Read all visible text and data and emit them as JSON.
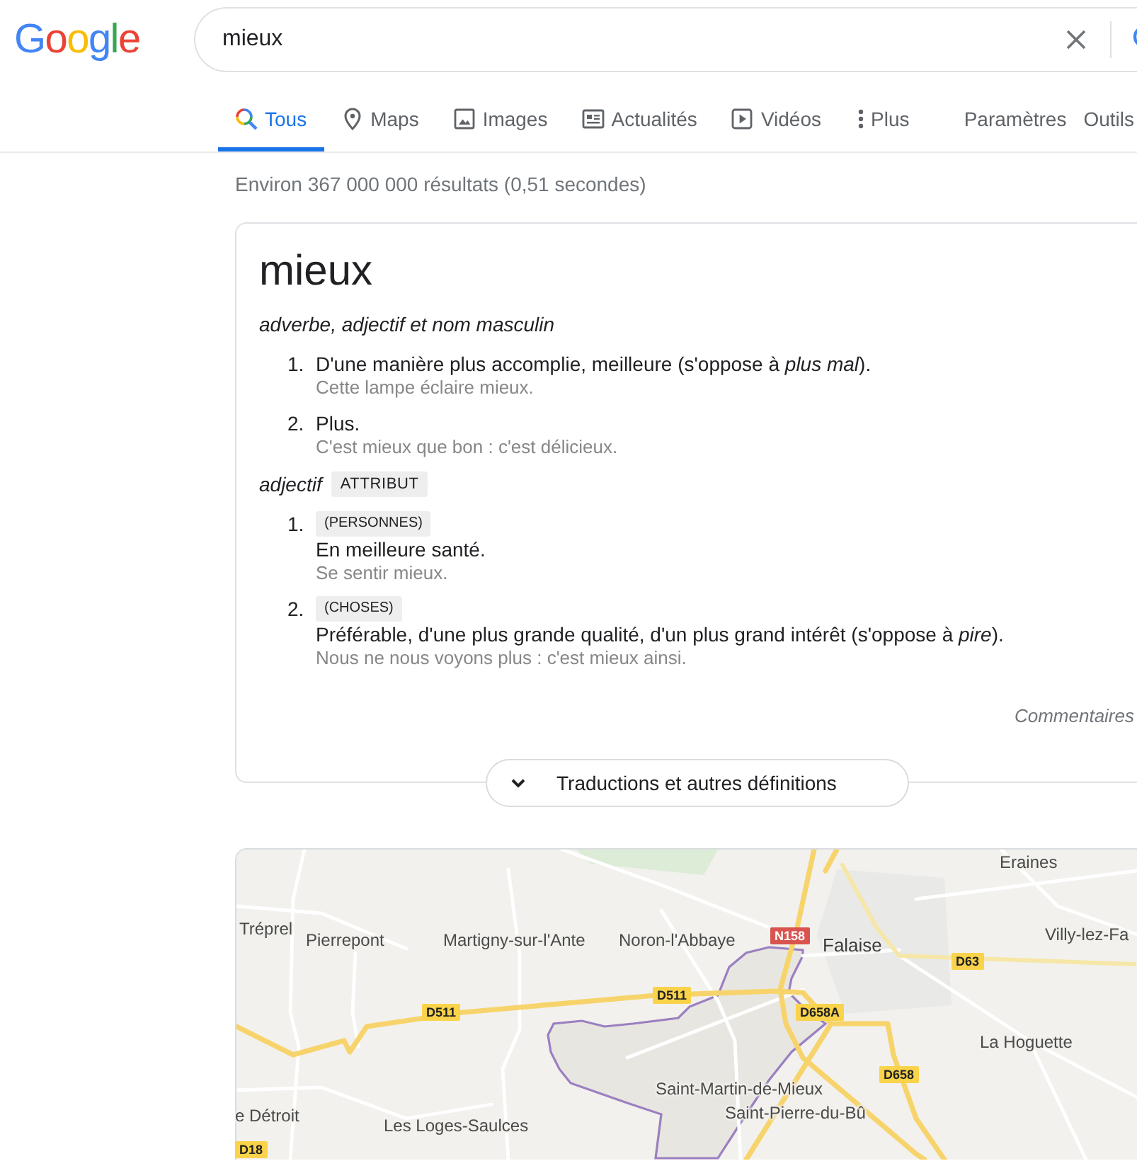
{
  "header": {
    "logo": "Google",
    "search": {
      "value": "mieux"
    }
  },
  "tabs": [
    {
      "kind": "all",
      "label": "Tous",
      "selected": true
    },
    {
      "kind": "maps",
      "label": "Maps",
      "selected": false
    },
    {
      "kind": "images",
      "label": "Images",
      "selected": false
    },
    {
      "kind": "news",
      "label": "Actualités",
      "selected": false
    },
    {
      "kind": "videos",
      "label": "Vidéos",
      "selected": false
    },
    {
      "kind": "more",
      "label": "Plus",
      "selected": false
    }
  ],
  "tools": [
    "Paramètres",
    "Outils"
  ],
  "result_stats": "Environ 367 000 000 résultats (0,51 secondes)",
  "definition": {
    "word": "mieux",
    "senses": [
      {
        "pos": "adverbe, adjectif et nom masculin",
        "definitions": [
          {
            "number": "1.",
            "text": "D'une manière plus accomplie, meilleure (s'oppose à *plus mal*).",
            "example": "Cette lampe éclaire mieux."
          },
          {
            "number": "2.",
            "text": "Plus.",
            "example": "C'est mieux que bon : c'est délicieux."
          }
        ]
      },
      {
        "pos": "adjectif",
        "tag": "ATTRIBUT",
        "definitions": [
          {
            "number": "1.",
            "label": "(PERSONNES)",
            "text": "En meilleure santé.",
            "example": "Se sentir mieux."
          },
          {
            "number": "2.",
            "label": "(CHOSES)",
            "text": "Préférable, d'une plus grande qualité, d'un plus grand intérêt (s'oppose à *pire*).",
            "example": "Nous ne nous voyons plus : c'est mieux ainsi."
          }
        ]
      }
    ],
    "feedback": "Commentaires",
    "more_button": "Traductions et autres définitions"
  },
  "map": {
    "places": [
      {
        "kind": "village",
        "name": "Eraines"
      },
      {
        "kind": "village",
        "name": "Tréprel"
      },
      {
        "kind": "village",
        "name": "Pierrepont"
      },
      {
        "kind": "village",
        "name": "Martigny-sur-l'Ante"
      },
      {
        "kind": "village",
        "name": "Noron-l'Abbaye"
      },
      {
        "kind": "town",
        "name": "Falaise"
      },
      {
        "kind": "village",
        "name": "Villy-lez-Fa"
      },
      {
        "kind": "village",
        "name": "La Hoguette"
      },
      {
        "kind": "village",
        "name": "Saint-Martin-de-Mieux"
      },
      {
        "kind": "village",
        "name": "e Détroit"
      },
      {
        "kind": "village",
        "name": "Saint-Pierre-du-Bû"
      },
      {
        "kind": "village",
        "name": "Les Loges-Saulces"
      }
    ],
    "road_numbers": [
      {
        "label": "N158",
        "color": "#d9534f"
      },
      {
        "label": "D63",
        "color": "#f9d34a"
      },
      {
        "label": "D511",
        "color": "#f9d34a"
      },
      {
        "label": "D511",
        "color": "#f9d34a"
      },
      {
        "label": "D658A",
        "color": "#f9d34a"
      },
      {
        "label": "D658",
        "color": "#f9d34a"
      },
      {
        "label": "D18",
        "color": "#f9d34a"
      }
    ]
  }
}
